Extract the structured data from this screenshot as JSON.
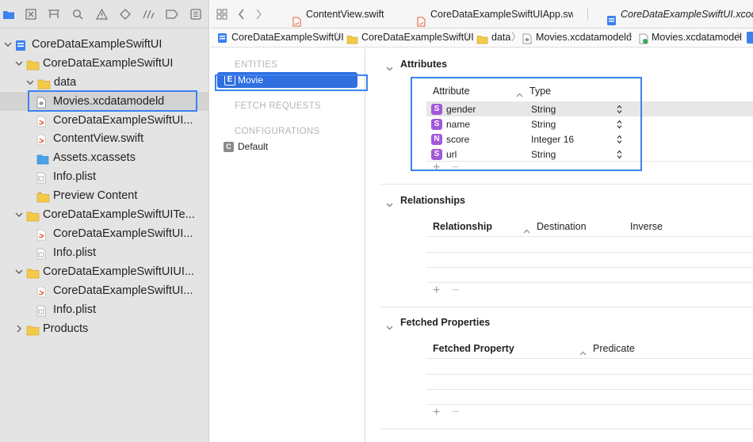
{
  "navigator": {
    "tree": [
      {
        "label": "CoreDataExampleSwiftUI",
        "icon": "xcode-project-icon"
      },
      {
        "label": "CoreDataExampleSwiftUI",
        "icon": "folder-icon"
      },
      {
        "label": "data",
        "icon": "folder-icon"
      },
      {
        "label": "Movies.xcdatamodeld",
        "icon": "data-model-icon"
      },
      {
        "label": "CoreDataExampleSwiftUI...",
        "icon": "swift-file-icon"
      },
      {
        "label": "ContentView.swift",
        "icon": "swift-file-icon"
      },
      {
        "label": "Assets.xcassets",
        "icon": "assets-icon"
      },
      {
        "label": "Info.plist",
        "icon": "plist-file-icon"
      },
      {
        "label": "Preview Content",
        "icon": "folder-icon"
      },
      {
        "label": "CoreDataExampleSwiftUITe...",
        "icon": "folder-icon"
      },
      {
        "label": "CoreDataExampleSwiftUI...",
        "icon": "swift-file-icon"
      },
      {
        "label": "Info.plist",
        "icon": "plist-file-icon"
      },
      {
        "label": "CoreDataExampleSwiftUIUI...",
        "icon": "folder-icon"
      },
      {
        "label": "CoreDataExampleSwiftUI...",
        "icon": "swift-file-icon"
      },
      {
        "label": "Info.plist",
        "icon": "plist-file-icon"
      },
      {
        "label": "Products",
        "icon": "folder-icon"
      }
    ]
  },
  "tabs": [
    {
      "label": "ContentView.swift"
    },
    {
      "label": "CoreDataExampleSwiftUIApp.swift"
    },
    {
      "label": "CoreDataExampleSwiftUI.xcodeproj"
    }
  ],
  "jump_bar": [
    "CoreDataExampleSwiftUI",
    "CoreDataExampleSwiftUI",
    "data",
    "Movies.xcdatamodeld",
    "Movies.xcdatamodel"
  ],
  "entity_pane": {
    "entities_header": "ENTITIES",
    "entity": "Movie",
    "fetch_header": "FETCH REQUESTS",
    "config_header": "CONFIGURATIONS",
    "config": "Default"
  },
  "attributes": {
    "title": "Attributes",
    "col_attribute": "Attribute",
    "col_type": "Type",
    "rows": [
      {
        "badge": "S",
        "name": "gender",
        "type": "String"
      },
      {
        "badge": "S",
        "name": "name",
        "type": "String"
      },
      {
        "badge": "N",
        "name": "score",
        "type": "Integer 16"
      },
      {
        "badge": "S",
        "name": "url",
        "type": "String"
      }
    ]
  },
  "relationships": {
    "title": "Relationships",
    "col_relationship": "Relationship",
    "col_destination": "Destination",
    "col_inverse": "Inverse"
  },
  "fetched": {
    "title": "Fetched Properties",
    "col_property": "Fetched Property",
    "col_predicate": "Predicate"
  },
  "buttons": {
    "add": "+",
    "remove": "−"
  },
  "colors": {
    "accent": "#3b82f0",
    "selection": "#2f6fe0",
    "badge_purple": "#a259d9"
  }
}
